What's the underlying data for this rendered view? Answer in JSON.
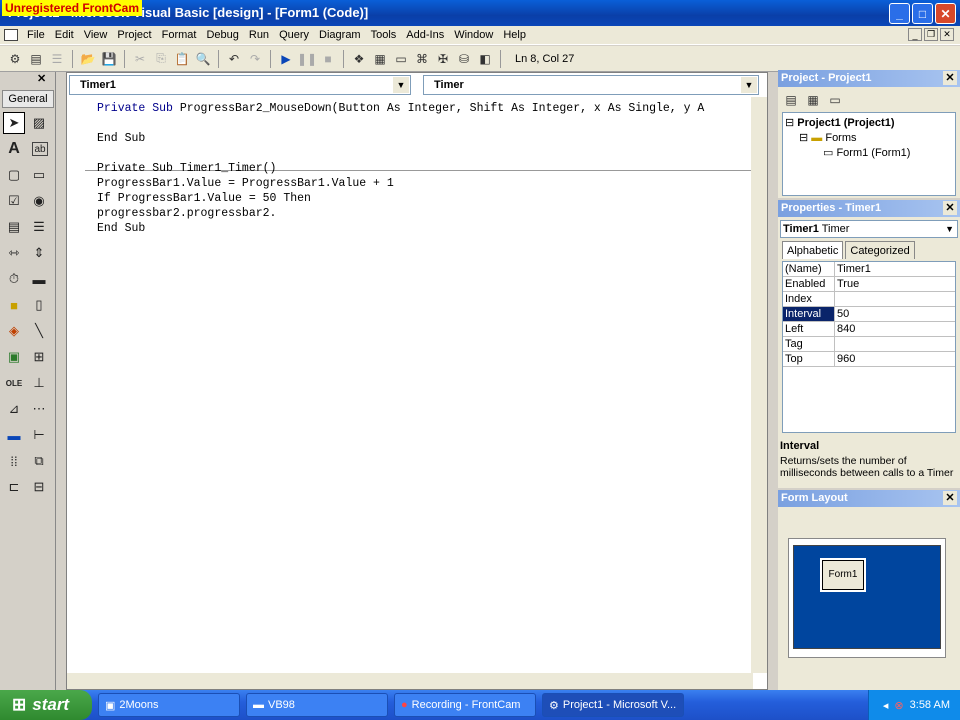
{
  "window": {
    "title": "Project1 - Microsoft Visual Basic [design] - [Form1 (Code)]",
    "watermark": "Unregistered FrontCam"
  },
  "menu": [
    "File",
    "Edit",
    "View",
    "Project",
    "Format",
    "Debug",
    "Run",
    "Query",
    "Diagram",
    "Tools",
    "Add-Ins",
    "Window",
    "Help"
  ],
  "toolbar": {
    "cursor_position": "Ln 8, Col 27"
  },
  "toolbox": {
    "tab_label": "General"
  },
  "code_window": {
    "object_combo": "Timer1",
    "procedure_combo": "Timer",
    "lines": [
      "Private Sub ProgressBar2_MouseDown(Button As Integer, Shift As Integer, x As Single, y A",
      "",
      "End Sub",
      "",
      "Private Sub Timer1_Timer()",
      "ProgressBar1.Value = ProgressBar1.Value + 1",
      "If ProgressBar1.Value = 50 Then",
      "progressbar2.progressbar2.",
      "End Sub"
    ]
  },
  "project_panel": {
    "title": "Project - Project1",
    "tree": {
      "project": "Project1 (Project1)",
      "folder": "Forms",
      "form": "Form1 (Form1)"
    }
  },
  "properties_panel": {
    "title": "Properties - Timer1",
    "object_name": "Timer1",
    "object_type": "Timer",
    "tabs": [
      "Alphabetic",
      "Categorized"
    ],
    "rows": [
      {
        "key": "(Name)",
        "value": "Timer1"
      },
      {
        "key": "Enabled",
        "value": "True"
      },
      {
        "key": "Index",
        "value": ""
      },
      {
        "key": "Interval",
        "value": "50"
      },
      {
        "key": "Left",
        "value": "840"
      },
      {
        "key": "Tag",
        "value": ""
      },
      {
        "key": "Top",
        "value": "960"
      }
    ],
    "description_title": "Interval",
    "description_text": "Returns/sets the number of milliseconds between calls to a Timer"
  },
  "form_layout": {
    "title": "Form Layout",
    "form_label": "Form1"
  },
  "taskbar": {
    "start_label": "start",
    "tasks": [
      "2Moons",
      "VB98",
      "Recording - FrontCam",
      "Project1 - Microsoft V..."
    ],
    "clock": "3:58 AM"
  },
  "colors": {
    "accent_blue": "#0a246a",
    "keyword_blue": "#00008b",
    "layout_screen": "#00459e"
  }
}
